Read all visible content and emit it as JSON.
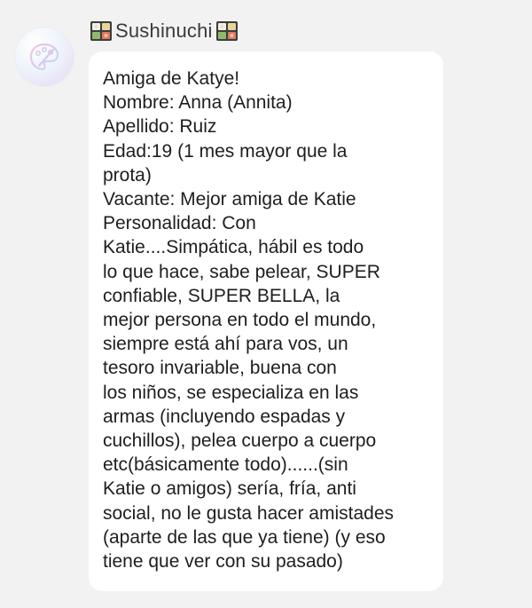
{
  "sender": {
    "name": "Sushinuchi",
    "avatar_icon": "paint-palette-icon",
    "name_decoration_icon": "bento-box-icon"
  },
  "message": {
    "text": "Amiga de Katye!\nNombre: Anna (Annita)\nApellido: Ruiz\nEdad:19 (1 mes mayor que la\nprota)\nVacante: Mejor amiga de Katie\nPersonalidad: Con\nKatie....Simpática, hábil es todo\nlo que hace, sabe pelear, SUPER\nconfiable, SUPER BELLA, la\nmejor persona en todo el mundo,\nsiempre está ahí para vos, un\ntesoro invariable, buena con\nlos niños, se especializa en las\narmas (incluyendo espadas y\ncuchillos), pelea cuerpo a cuerpo\netc(básicamente todo)......(sin\nKatie o amigos) sería, fría, anti\nsocial, no le gusta hacer amistades\n(aparte de las que ya tiene) (y eso\ntiene que ver con su pasado)"
  },
  "colors": {
    "background": "#f2f2f2",
    "bubble": "#ffffff",
    "text": "#1e1e1e",
    "username": "#3a3a3a"
  }
}
